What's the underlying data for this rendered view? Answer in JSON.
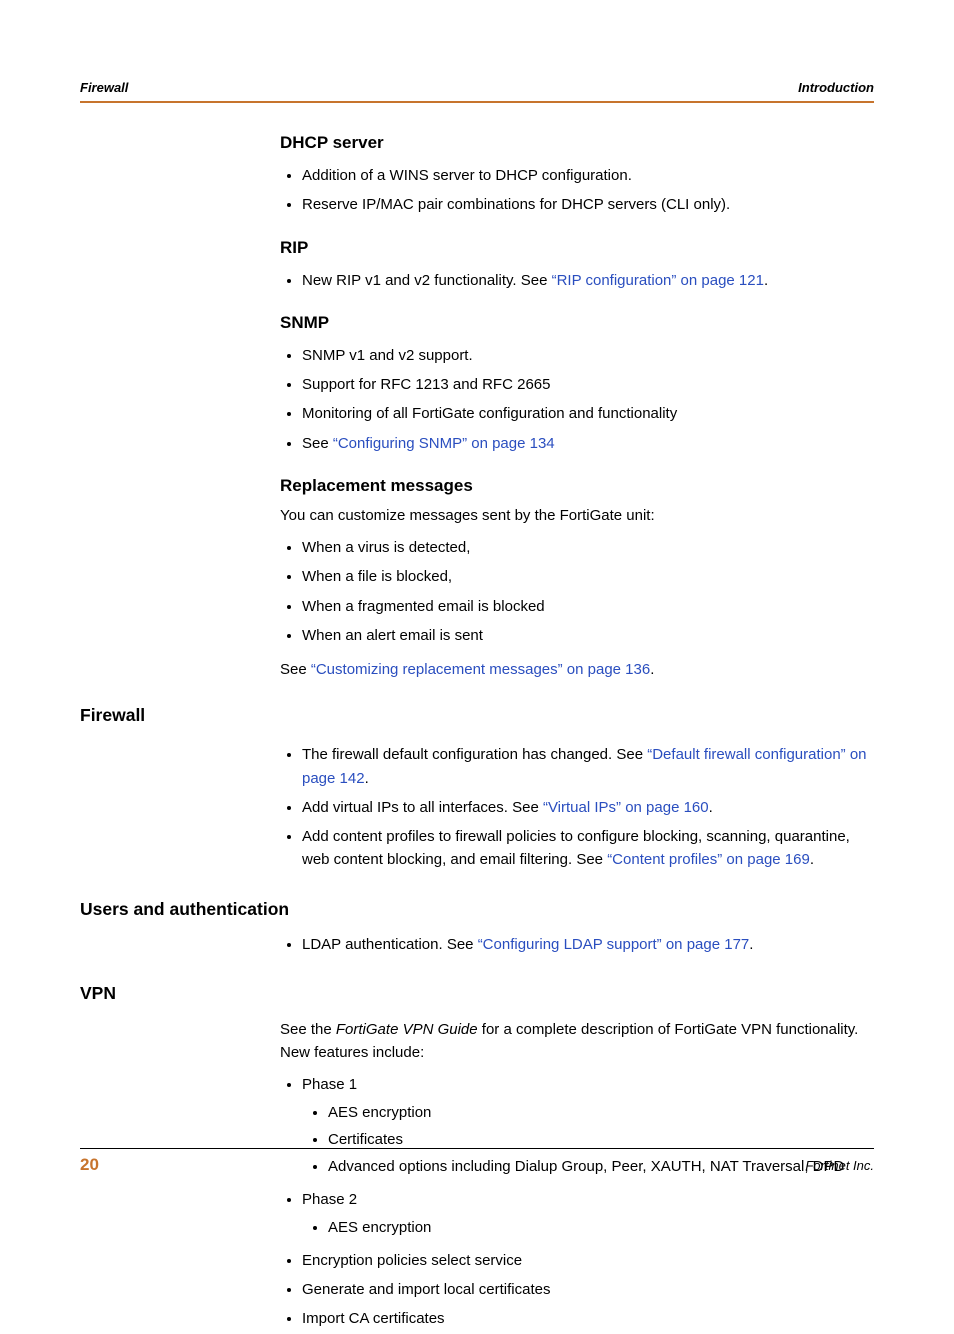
{
  "header": {
    "left": "Firewall",
    "right": "Introduction"
  },
  "sections": {
    "dhcp": {
      "title": "DHCP server",
      "items": [
        "Addition of a WINS server to DHCP configuration.",
        "Reserve IP/MAC pair combinations for DHCP servers (CLI only)."
      ]
    },
    "rip": {
      "title": "RIP",
      "item_prefix": "New RIP v1 and v2 functionality. See ",
      "link": "“RIP configuration” on page 121",
      "suffix": "."
    },
    "snmp": {
      "title": "SNMP",
      "items": [
        "SNMP v1 and v2 support.",
        "Support for RFC 1213 and RFC 2665",
        "Monitoring of all FortiGate configuration and functionality"
      ],
      "see_prefix": "See ",
      "see_link": "“Configuring SNMP” on page 134"
    },
    "replacement": {
      "title": "Replacement messages",
      "intro": "You can customize messages sent by the FortiGate unit:",
      "items": [
        "When a virus is detected,",
        "When a file is blocked,",
        "When a fragmented email is blocked",
        "When an alert email is sent"
      ],
      "see_prefix": "See ",
      "see_link": "“Customizing replacement messages” on page 136",
      "see_suffix": "."
    },
    "firewall": {
      "title": "Firewall",
      "item1_prefix": "The firewall default configuration has changed. See ",
      "item1_link": "“Default firewall configuration” on page 142",
      "item1_suffix": ".",
      "item2_prefix": "Add virtual IPs to all interfaces. See ",
      "item2_link": "“Virtual IPs” on page 160",
      "item2_suffix": ".",
      "item3_prefix": "Add content profiles to firewall policies to configure blocking, scanning, quarantine, web content blocking, and email filtering. See ",
      "item3_link": "“Content profiles” on page 169",
      "item3_suffix": "."
    },
    "users": {
      "title": "Users and authentication",
      "item_prefix": "LDAP authentication. See ",
      "link": "“Configuring LDAP support” on page 177",
      "suffix": "."
    },
    "vpn": {
      "title": "VPN",
      "intro_pre": "See the ",
      "intro_em": "FortiGate VPN Guide",
      "intro_post": " for a complete description of FortiGate VPN functionality. New features include:",
      "phase1_label": "Phase 1",
      "phase1_items": [
        "AES encryption",
        "Certificates",
        "Advanced options including Dialup Group, Peer, XAUTH, NAT Traversal, DPD"
      ],
      "phase2_label": "Phase 2",
      "phase2_items": [
        "AES encryption"
      ],
      "tail_items": [
        "Encryption policies select service",
        "Generate and import local certificates",
        "Import CA certificates"
      ]
    }
  },
  "footer": {
    "page": "20",
    "publisher": "Fortinet Inc."
  }
}
